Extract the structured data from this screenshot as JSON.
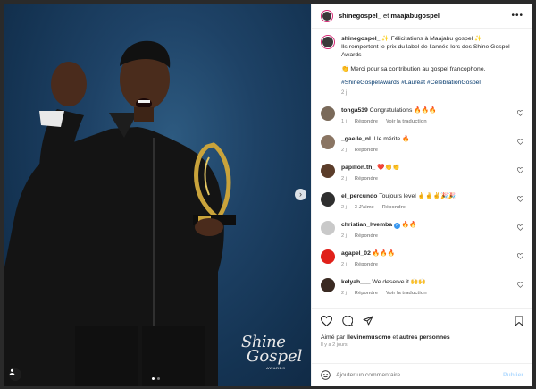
{
  "post": {
    "header_user1": "shinegospel_",
    "header_connector": "et",
    "header_user2": "maajabugospel",
    "caption": {
      "user": "shinegospel_",
      "line1": "✨ Félicitations à Maajabu gospel ✨",
      "line2": "Ils remportent le prix du label de l'année lors des Shine Gospel Awards !",
      "line3": "👏 Merci pour sa contribution au gospel francophone.",
      "hashtags": "#ShineGospelAwards #Lauréat #CélébrationGospel",
      "time": "2 j"
    }
  },
  "comments": [
    {
      "user": "tonga539",
      "text": "Congratulations 🔥🔥🔥",
      "time": "1 j",
      "reply": "Répondre",
      "translate": "Voir la traduction",
      "avatar_color": "#7a6a5a"
    },
    {
      "user": "_gaelle_nl",
      "text": "Il le mérite 🔥",
      "time": "2 j",
      "reply": "Répondre",
      "avatar_color": "#8a7563"
    },
    {
      "user": "papillon.th_",
      "text": "❤️👏👏",
      "time": "2 j",
      "reply": "Répondre",
      "avatar_color": "#5b3d2a"
    },
    {
      "user": "el_percundo",
      "text": "Toujours level ✌️✌️✌️🎉🎉",
      "time": "2 j",
      "likes": "3 J'aime",
      "reply": "Répondre",
      "avatar_color": "#2f2f2f"
    },
    {
      "user": "christian_lwemba",
      "text": "🔥🔥",
      "time": "2 j",
      "reply": "Répondre",
      "avatar_color": "#c9c9c9"
    },
    {
      "user": "agapel_02",
      "text": "🔥🔥🔥",
      "time": "2 j",
      "reply": "Répondre",
      "avatar_color": "#e0201a"
    },
    {
      "user": "kelyah___",
      "text": "We deserve it 🙌🙌",
      "time": "2 j",
      "reply": "Répondre",
      "translate": "Voir la traduction",
      "avatar_color": "#3a2a22"
    }
  ],
  "actions": {
    "liked_prefix": "Aimé par",
    "liked_user": "llevinemusomo",
    "liked_mid": "et",
    "liked_others": "autres personnes",
    "ago": "Il y a 2 jours"
  },
  "composer": {
    "placeholder": "Ajouter un commentaire...",
    "publish": "Publier"
  },
  "photo": {
    "logo_line1": "Shine",
    "logo_line2": "Gospel",
    "logo_line3": "AWARDS"
  },
  "colors": {
    "accent": "#0095f6",
    "hashtag": "#00376b",
    "muted": "#8e8e8e"
  }
}
